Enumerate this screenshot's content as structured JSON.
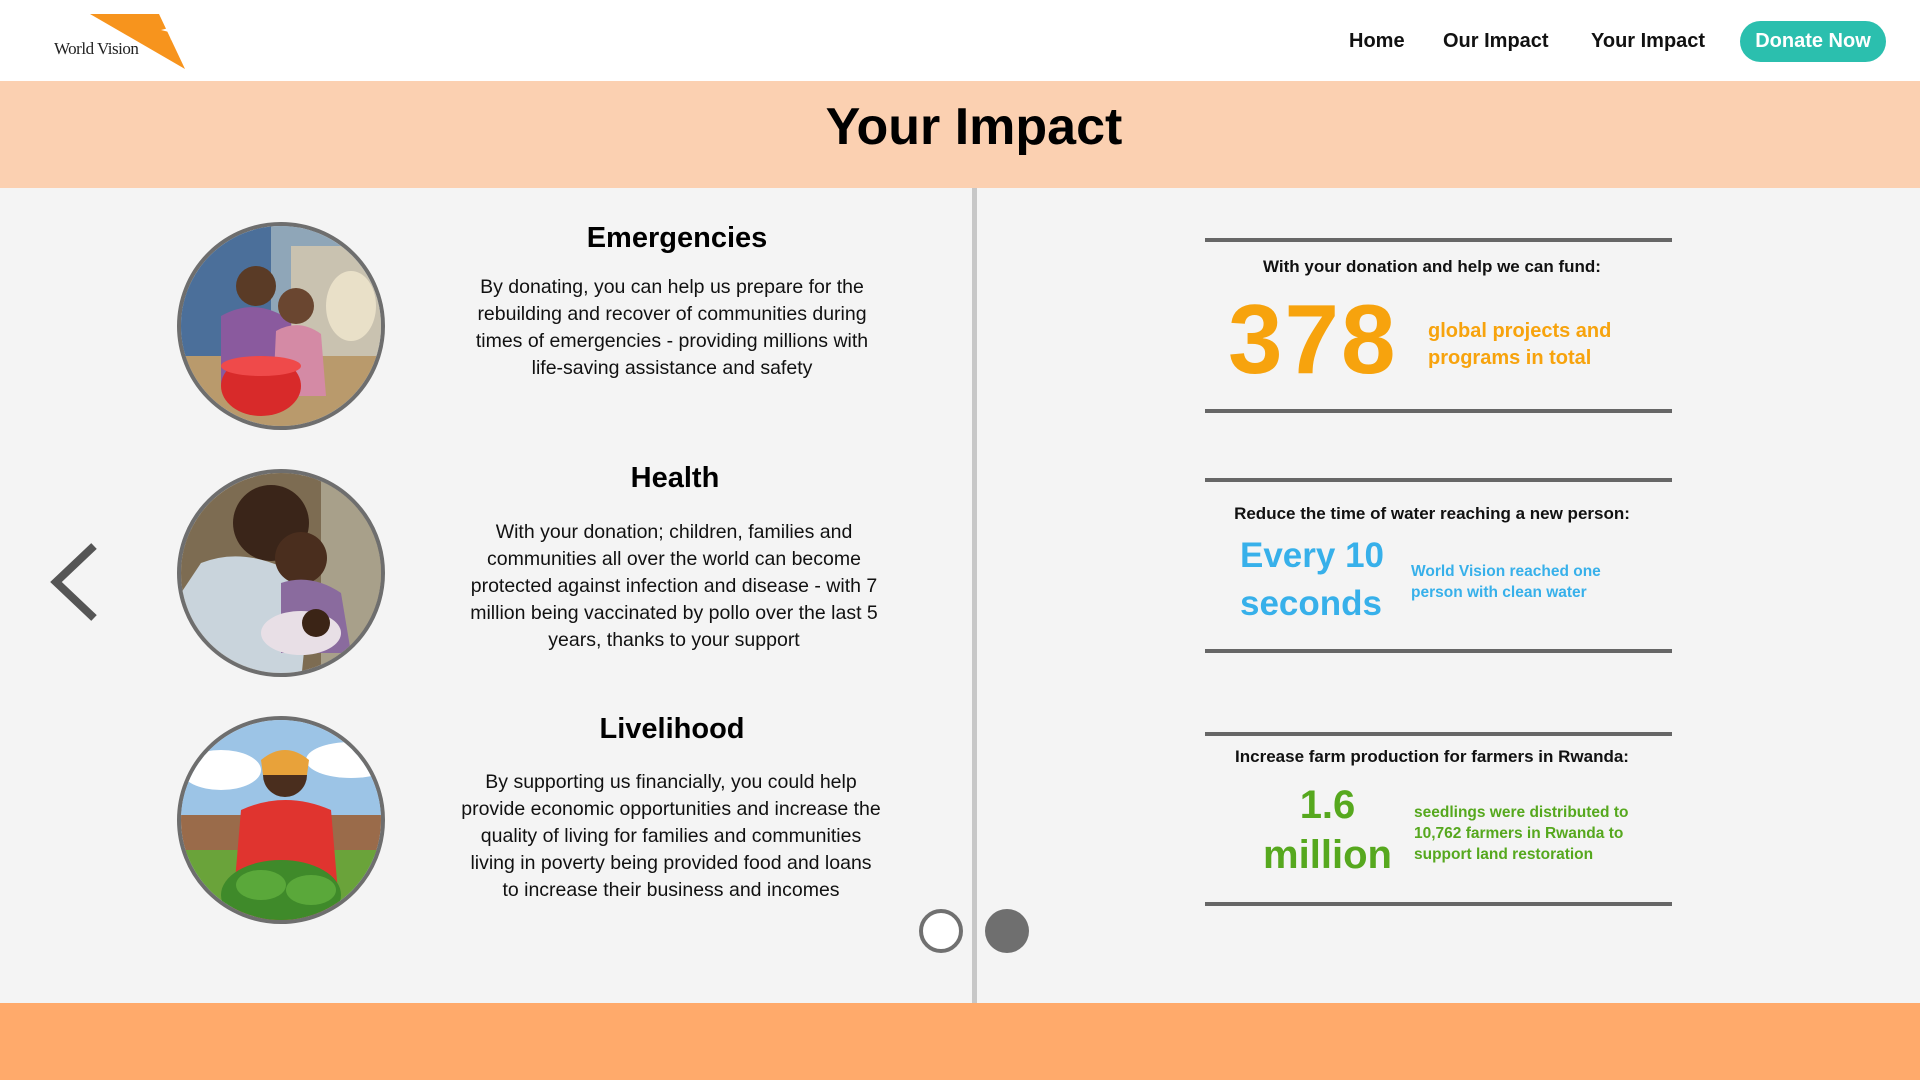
{
  "header": {
    "logo_text": "World Vision",
    "nav": [
      {
        "label": "Home"
      },
      {
        "label": "Our Impact"
      },
      {
        "label": "Your Impact"
      }
    ],
    "donate_label": "Donate Now"
  },
  "banner": {
    "title": "Your Impact"
  },
  "carousel": {
    "prev_icon": "chevron-left-icon",
    "items": [
      {
        "title": "Emergencies",
        "body": "By donating, you can help us prepare for the rebuilding and recover of communities during times of emergencies - providing millions with life-saving assistance and safety",
        "photo": "mother-and-child-photo"
      },
      {
        "title": "Health",
        "body": "With your donation; children, families and communities all over the world can become protected against infection and disease - with 7 million being vaccinated by pollo over the last 5 years, thanks to your support",
        "photo": "child-vaccination-photo"
      },
      {
        "title": "Livelihood",
        "body": "By supporting us financially, you could help provide economic opportunities and increase the quality of living for families and communities living in poverty being provided food and loans to increase their business and incomes",
        "photo": "farmer-with-greens-photo"
      }
    ],
    "page_count": 2,
    "active_page": 2
  },
  "stats": [
    {
      "heading": "With your donation and help we can fund:",
      "value": "378",
      "description": "global projects and programs in total",
      "color": "#f7a30d"
    },
    {
      "heading": "Reduce the time of water reaching a new person:",
      "value": "Every 10 seconds",
      "description": "World Vision reached one person with clean water",
      "color": "#37b0ea"
    },
    {
      "heading": "Increase farm production for farmers in Rwanda:",
      "value": "1.6 million",
      "description": "seedlings were distributed to 10,762 farmers in Rwanda to support land restoration",
      "color": "#56a81e"
    }
  ],
  "colors": {
    "banner": "#fbd0b1",
    "footer": "#ffaa6b",
    "donate": "#2bbfae",
    "panel": "#f4f4f4",
    "logo_orange": "#f7941d"
  }
}
